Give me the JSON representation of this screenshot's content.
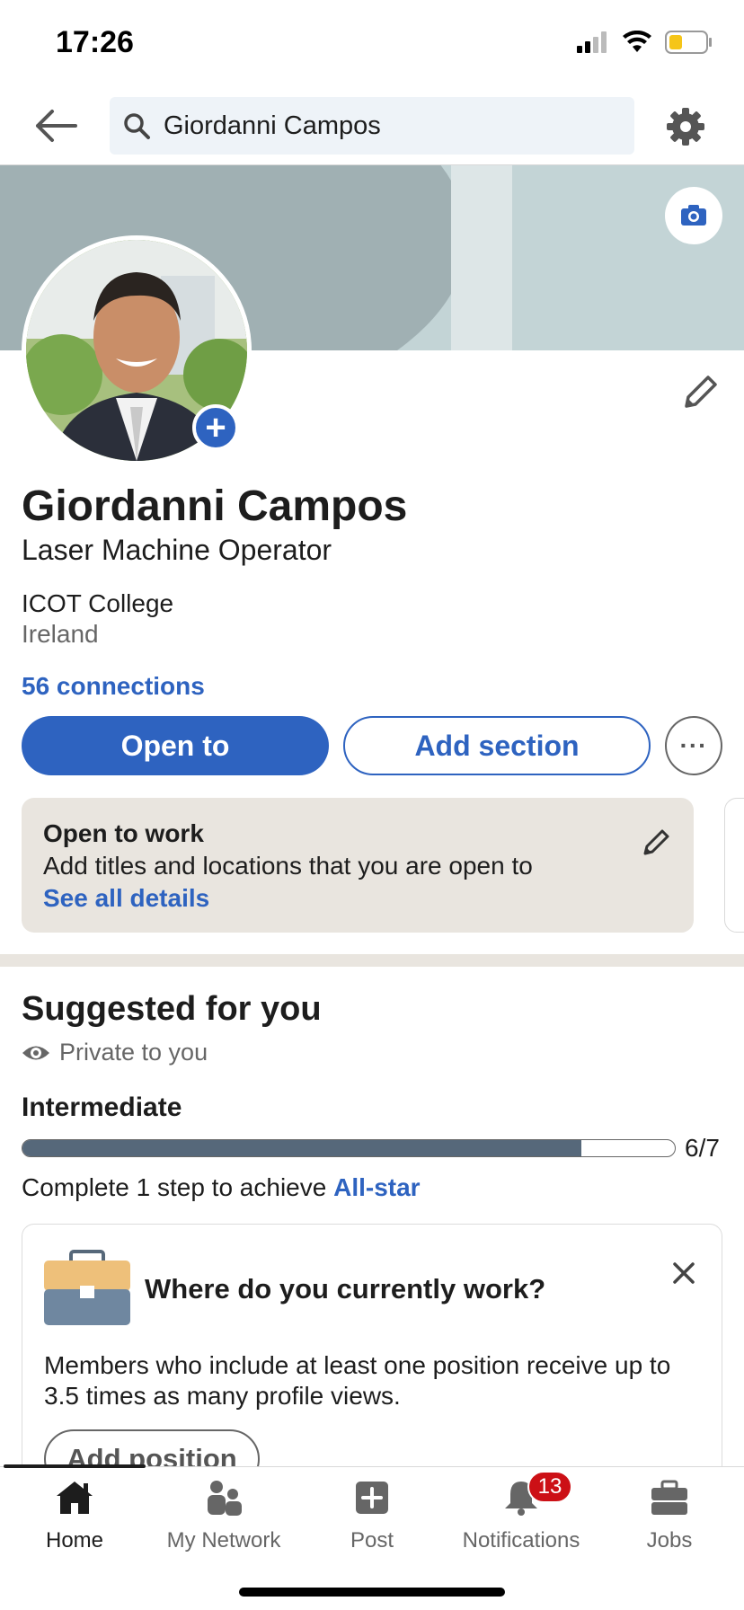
{
  "status_bar": {
    "time": "17:26"
  },
  "search": {
    "query": "Giordanni Campos"
  },
  "profile": {
    "name": "Giordanni Campos",
    "headline": "Laser Machine Operator",
    "school": "ICOT College",
    "location": "Ireland",
    "connections": "56 connections"
  },
  "actions": {
    "open_to": "Open to",
    "add_section": "Add section",
    "more": "···"
  },
  "open_to_work": {
    "title": "Open to work",
    "description": "Add titles and locations that you are open to",
    "link": "See all details"
  },
  "suggested": {
    "title": "Suggested for you",
    "privacy": "Private to you",
    "level": "Intermediate",
    "progress_fraction": 0.857,
    "progress_count": "6/7",
    "complete_prefix": "Complete 1 step to achieve ",
    "complete_link": "All-star"
  },
  "work_card": {
    "question": "Where do you currently work?",
    "description": "Members who include at least one position receive up to 3.5 times as many profile views.",
    "button": "Add position"
  },
  "bottom_nav": {
    "items": [
      {
        "label": "Home",
        "icon": "home-icon"
      },
      {
        "label": "My Network",
        "icon": "network-icon"
      },
      {
        "label": "Post",
        "icon": "post-icon"
      },
      {
        "label": "Notifications",
        "icon": "bell-icon"
      },
      {
        "label": "Jobs",
        "icon": "briefcase-icon"
      }
    ],
    "notification_badge": "13"
  },
  "colors": {
    "accent": "#2e63c0",
    "badge": "#cc1016",
    "cover": "#a0b0b3",
    "card_bg": "#e9e5df"
  }
}
